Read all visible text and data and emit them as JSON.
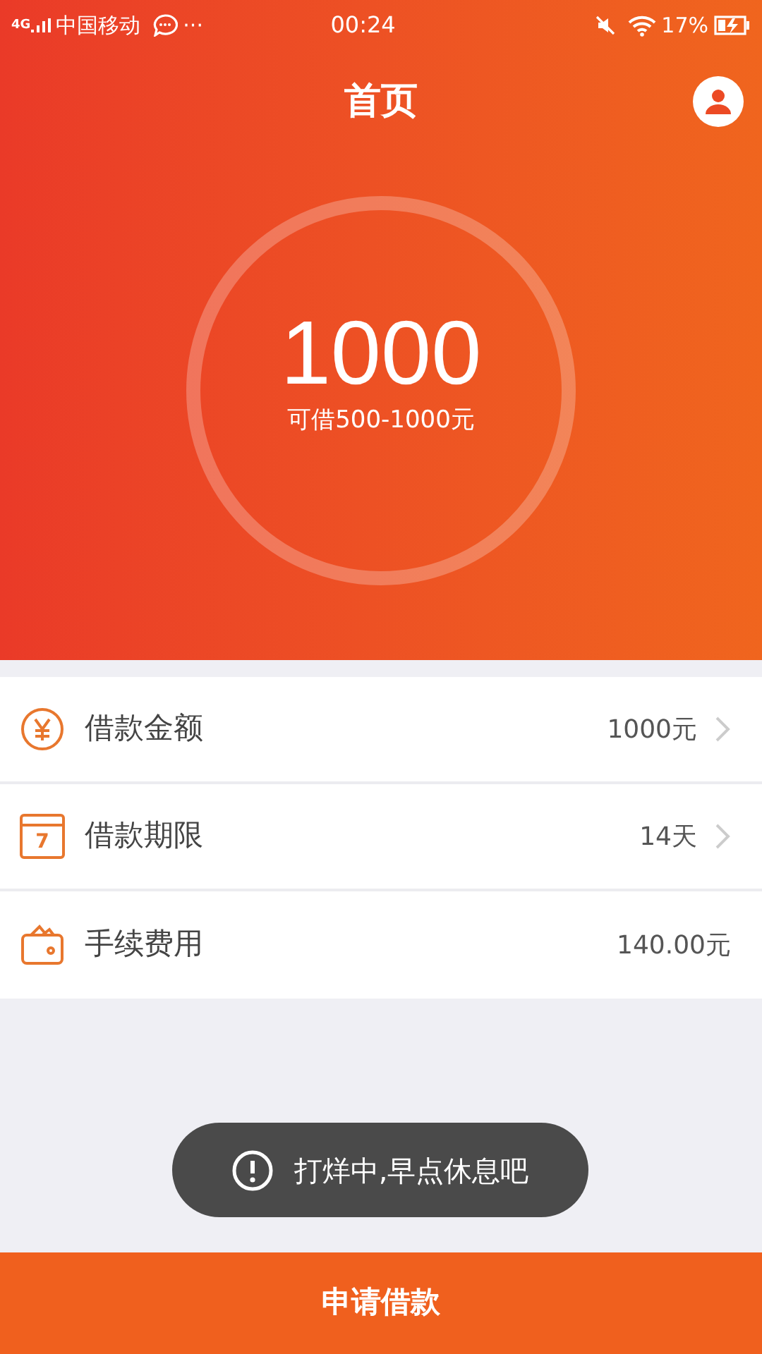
{
  "status_bar": {
    "network": "4G",
    "carrier": "中国移动",
    "more": "···",
    "time": "00:24",
    "battery": "17%"
  },
  "header": {
    "title": "首页"
  },
  "amount": {
    "value": "1000",
    "range": "可借500-1000元"
  },
  "rows": [
    {
      "kind": "yen",
      "label": "借款金额",
      "value": "1000元",
      "has_arrow": true
    },
    {
      "kind": "calendar",
      "icon_text": "7",
      "label": "借款期限",
      "value": "14天",
      "has_arrow": true
    },
    {
      "kind": "wallet",
      "label": "手续费用",
      "value": "140.00元",
      "has_arrow": false
    }
  ],
  "toast": {
    "text": "打烊中,早点休息吧"
  },
  "submit_button": {
    "label": "申请借款"
  }
}
